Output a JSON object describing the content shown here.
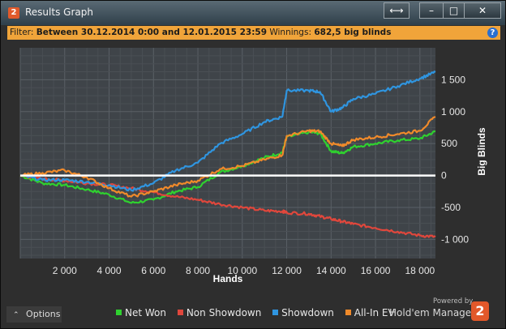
{
  "window": {
    "app_badge": "2",
    "title": "Results Graph",
    "buttons": [
      "swap-icon",
      "minimize-icon",
      "maximize-icon",
      "close-icon"
    ]
  },
  "filter": {
    "label": "Filter:",
    "range": "Between 30.12.2014 0:00 and 12.01.2015 23:59",
    "winnings_label": "Winnings:",
    "winnings_value": "682,5 big blinds",
    "help": "?"
  },
  "options": {
    "label": "Options",
    "icon": "chevron-up-icon"
  },
  "branding": {
    "powered": "Powered by",
    "name": "Hold'em Manager",
    "logo": "2"
  },
  "colors": {
    "net_won": "#2fd12f",
    "non_showdown": "#e0473c",
    "showdown": "#2f95e0",
    "all_in_ev": "#f08a2a",
    "zero_line": "#ffffff",
    "filter_bar": "#f0a43a"
  },
  "chart_data": {
    "type": "line",
    "xlabel": "Hands",
    "ylabel": "Big Blinds",
    "xlim": [
      0,
      18700
    ],
    "ylim": [
      -1300,
      2000
    ],
    "xticks": [
      2000,
      4000,
      6000,
      8000,
      10000,
      12000,
      14000,
      16000,
      18000
    ],
    "xtick_labels": [
      "2 000",
      "4 000",
      "6 000",
      "8 000",
      "10 000",
      "12 000",
      "14 000",
      "16 000",
      "18 000"
    ],
    "yticks": [
      1500,
      1000,
      500,
      0,
      -500,
      -1000
    ],
    "ytick_labels": [
      "1 500",
      "1 000",
      "500",
      "0",
      "-500",
      "-1 000"
    ],
    "grid": true,
    "legend": "bottom",
    "x": [
      0,
      1000,
      2000,
      3000,
      4000,
      5000,
      6000,
      7000,
      8000,
      9000,
      10000,
      11000,
      11800,
      12000,
      13000,
      13500,
      14000,
      14500,
      15000,
      16000,
      17000,
      18000,
      18700
    ],
    "series": [
      {
        "name": "Net Won",
        "color": "#2fd12f",
        "values": [
          0,
          -120,
          -150,
          -220,
          -300,
          -430,
          -380,
          -250,
          -180,
          50,
          150,
          280,
          360,
          600,
          680,
          660,
          380,
          350,
          450,
          500,
          550,
          580,
          690
        ]
      },
      {
        "name": "Non Showdown",
        "color": "#e0473c",
        "values": [
          0,
          -50,
          -80,
          -120,
          -150,
          -200,
          -260,
          -330,
          -380,
          -450,
          -500,
          -550,
          -560,
          -580,
          -600,
          -640,
          -680,
          -720,
          -760,
          -820,
          -880,
          -940,
          -960
        ]
      },
      {
        "name": "Showdown",
        "color": "#2f95e0",
        "values": [
          0,
          -70,
          -70,
          -100,
          -150,
          -230,
          -120,
          80,
          200,
          500,
          650,
          840,
          920,
          1330,
          1330,
          1310,
          1000,
          1060,
          1200,
          1280,
          1400,
          1520,
          1620
        ]
      },
      {
        "name": "All-In EV",
        "color": "#f08a2a",
        "values": [
          0,
          40,
          80,
          -30,
          -200,
          -330,
          -250,
          -150,
          -80,
          100,
          150,
          250,
          320,
          620,
          700,
          690,
          500,
          460,
          560,
          600,
          650,
          700,
          920
        ]
      }
    ]
  }
}
